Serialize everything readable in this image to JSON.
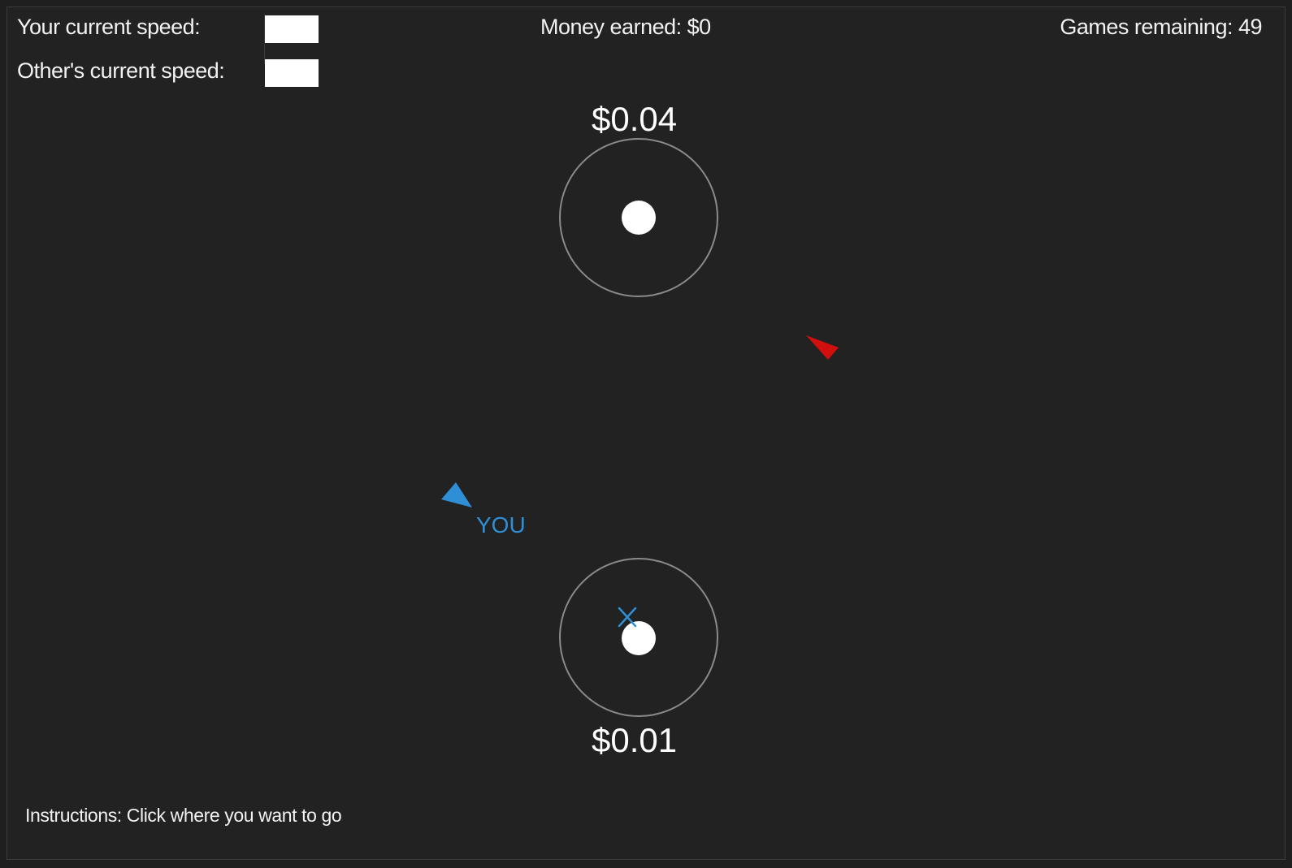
{
  "hud": {
    "your_speed_label": "Your current speed:",
    "others_speed_label": "Other's current speed:",
    "money_earned": "Money earned: $0",
    "games_remaining": "Games remaining: 49",
    "your_speed_value": "",
    "others_speed_value": ""
  },
  "targets": {
    "top_reward": "$0.04",
    "bottom_reward": "$0.01"
  },
  "player": {
    "label": "YOU",
    "color": "#2e8fd6"
  },
  "opponent": {
    "color": "#d10f0f"
  },
  "destination_marker": {
    "icon": "x-mark-icon",
    "color": "#2e8fd6"
  },
  "instructions": "Instructions: Click where you want to go",
  "colors": {
    "background": "#222222",
    "target_ring": "#8a8a8a",
    "target_center": "#ffffff"
  }
}
